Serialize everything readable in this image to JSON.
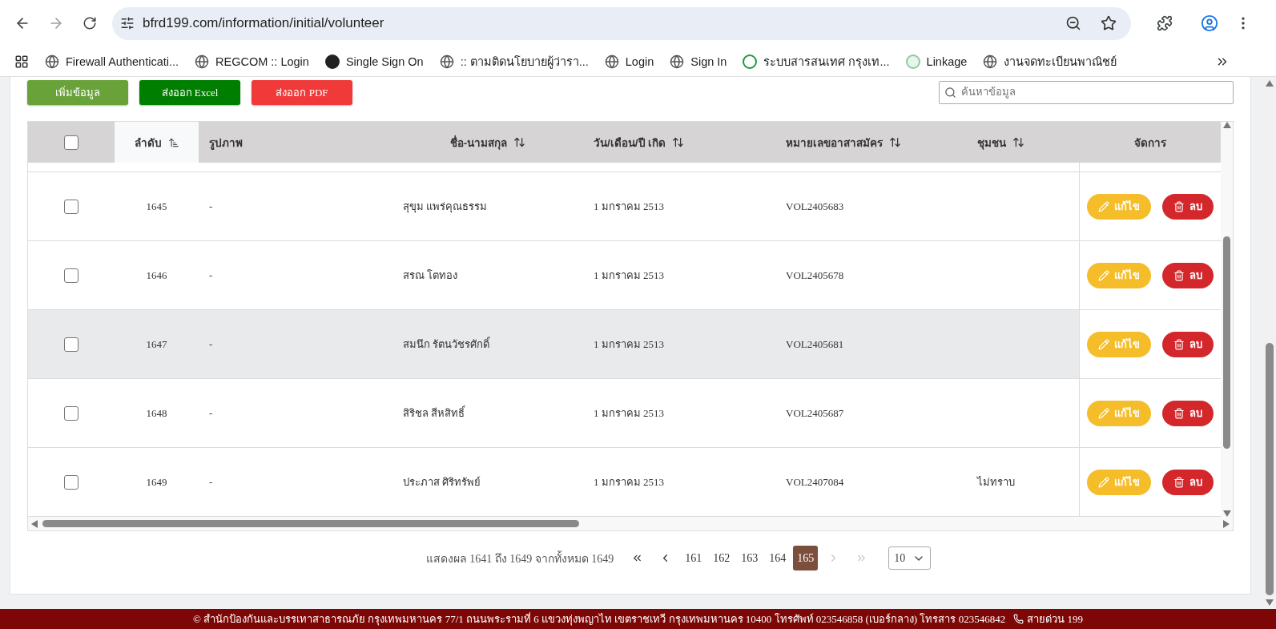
{
  "browser": {
    "url": "bfrd199.com/information/initial/volunteer",
    "bookmarks": [
      {
        "label": "Firewall Authenticati...",
        "kind": "globe"
      },
      {
        "label": "REGCOM :: Login",
        "kind": "globe"
      },
      {
        "label": "Single Sign On",
        "kind": "dark"
      },
      {
        "label": ":: ตามติดนโยบายผู้ว่ารา...",
        "kind": "globe"
      },
      {
        "label": "Login",
        "kind": "globe"
      },
      {
        "label": "Sign In",
        "kind": "globe"
      },
      {
        "label": "ระบบสารสนเทศ กรุงเท...",
        "kind": "green"
      },
      {
        "label": "Linkage",
        "kind": "light"
      },
      {
        "label": "งานจดทะเบียนพาณิชย์",
        "kind": "globe"
      }
    ]
  },
  "toolbar": {
    "buttons": [
      {
        "label": "เพิ่มข้อมูล",
        "kind": "add"
      },
      {
        "label": "ส่งออก Excel",
        "kind": "excel"
      },
      {
        "label": "ส่งออก PDF",
        "kind": "pdf"
      }
    ],
    "search": {
      "placeholder": "ค้นหาข้อมูล"
    }
  },
  "table": {
    "select_all": {
      "checked": false
    },
    "columns": [
      {
        "label": "ลำดับ",
        "kind": "sorted"
      },
      {
        "label": "รูปภาพ",
        "kind": "plain"
      },
      {
        "label": "ชื่อ-นามสกุล",
        "kind": "sortable"
      },
      {
        "label": "วัน/เดือน/ปี เกิด",
        "kind": "sortable"
      },
      {
        "label": "หมายเลขอาสาสมัคร",
        "kind": "sortable"
      },
      {
        "label": "ชุมชน",
        "kind": "sortable"
      },
      {
        "label": "จัดการ",
        "kind": "plain"
      }
    ],
    "rows": [
      {
        "checked": false,
        "highlighted": false,
        "seq": "1645",
        "photo": "-",
        "name": "สุขุม แพร่คุณธรรม",
        "birth_date": "1 มกราคม 2513",
        "volunteer_id": "VOL2405683",
        "actions": [
          {
            "label": "แก้ไข",
            "kind": "edit"
          },
          {
            "label": "ลบ",
            "kind": "delete"
          }
        ]
      },
      {
        "checked": false,
        "highlighted": false,
        "seq": "1646",
        "photo": "-",
        "name": "สรณ โตทอง",
        "birth_date": "1 มกราคม 2513",
        "volunteer_id": "VOL2405678",
        "actions": [
          {
            "label": "แก้ไข",
            "kind": "edit"
          },
          {
            "label": "ลบ",
            "kind": "delete"
          }
        ]
      },
      {
        "checked": false,
        "highlighted": true,
        "seq": "1647",
        "photo": "-",
        "name": "สมนึก รัตนวัชรศักดิ์",
        "birth_date": "1 มกราคม 2513",
        "volunteer_id": "VOL2405681",
        "actions": [
          {
            "label": "แก้ไข",
            "kind": "edit"
          },
          {
            "label": "ลบ",
            "kind": "delete"
          }
        ]
      },
      {
        "checked": false,
        "highlighted": false,
        "seq": "1648",
        "photo": "-",
        "name": "สิริชล สีหสิทธิ์",
        "birth_date": "1 มกราคม 2513",
        "volunteer_id": "VOL2405687",
        "actions": [
          {
            "label": "แก้ไข",
            "kind": "edit"
          },
          {
            "label": "ลบ",
            "kind": "delete"
          }
        ]
      },
      {
        "checked": false,
        "highlighted": false,
        "seq": "1649",
        "photo": "-",
        "name": "ประภาส ศิริทรัพย์",
        "birth_date": "1 มกราคม 2513",
        "volunteer_id": "VOL2407084",
        "community": "ไม่ทราบ",
        "actions": [
          {
            "label": "แก้ไข",
            "kind": "edit"
          },
          {
            "label": "ลบ",
            "kind": "delete"
          }
        ]
      }
    ]
  },
  "pagination": {
    "summary": "แสดงผล 1641 ถึง 1649 จากทั้งหมด 1649",
    "nav": [
      {
        "kind": "first",
        "disabled": false
      },
      {
        "kind": "prev",
        "disabled": false
      },
      {
        "kind": "next",
        "disabled": true
      },
      {
        "kind": "last",
        "disabled": true
      }
    ],
    "pages": [
      {
        "label": "161",
        "selected": false
      },
      {
        "label": "162",
        "selected": false
      },
      {
        "label": "163",
        "selected": false
      },
      {
        "label": "164",
        "selected": false
      },
      {
        "label": "165",
        "selected": true
      }
    ],
    "page_size": "10"
  },
  "footer": {
    "text": "© สำนักป้องกันและบรรเทาสาธารณภัย กรุงเทพมหานคร 77/1 ถนนพระรามที่ 6 แขวงทุ่งพญาไท เขตราชเทวี กรุงเทพมหานคร 10400 โทรศัพท์ 023546858 (เบอร์กลาง) โทรสาร 023546842",
    "hotline": "สายด่วน 199"
  }
}
